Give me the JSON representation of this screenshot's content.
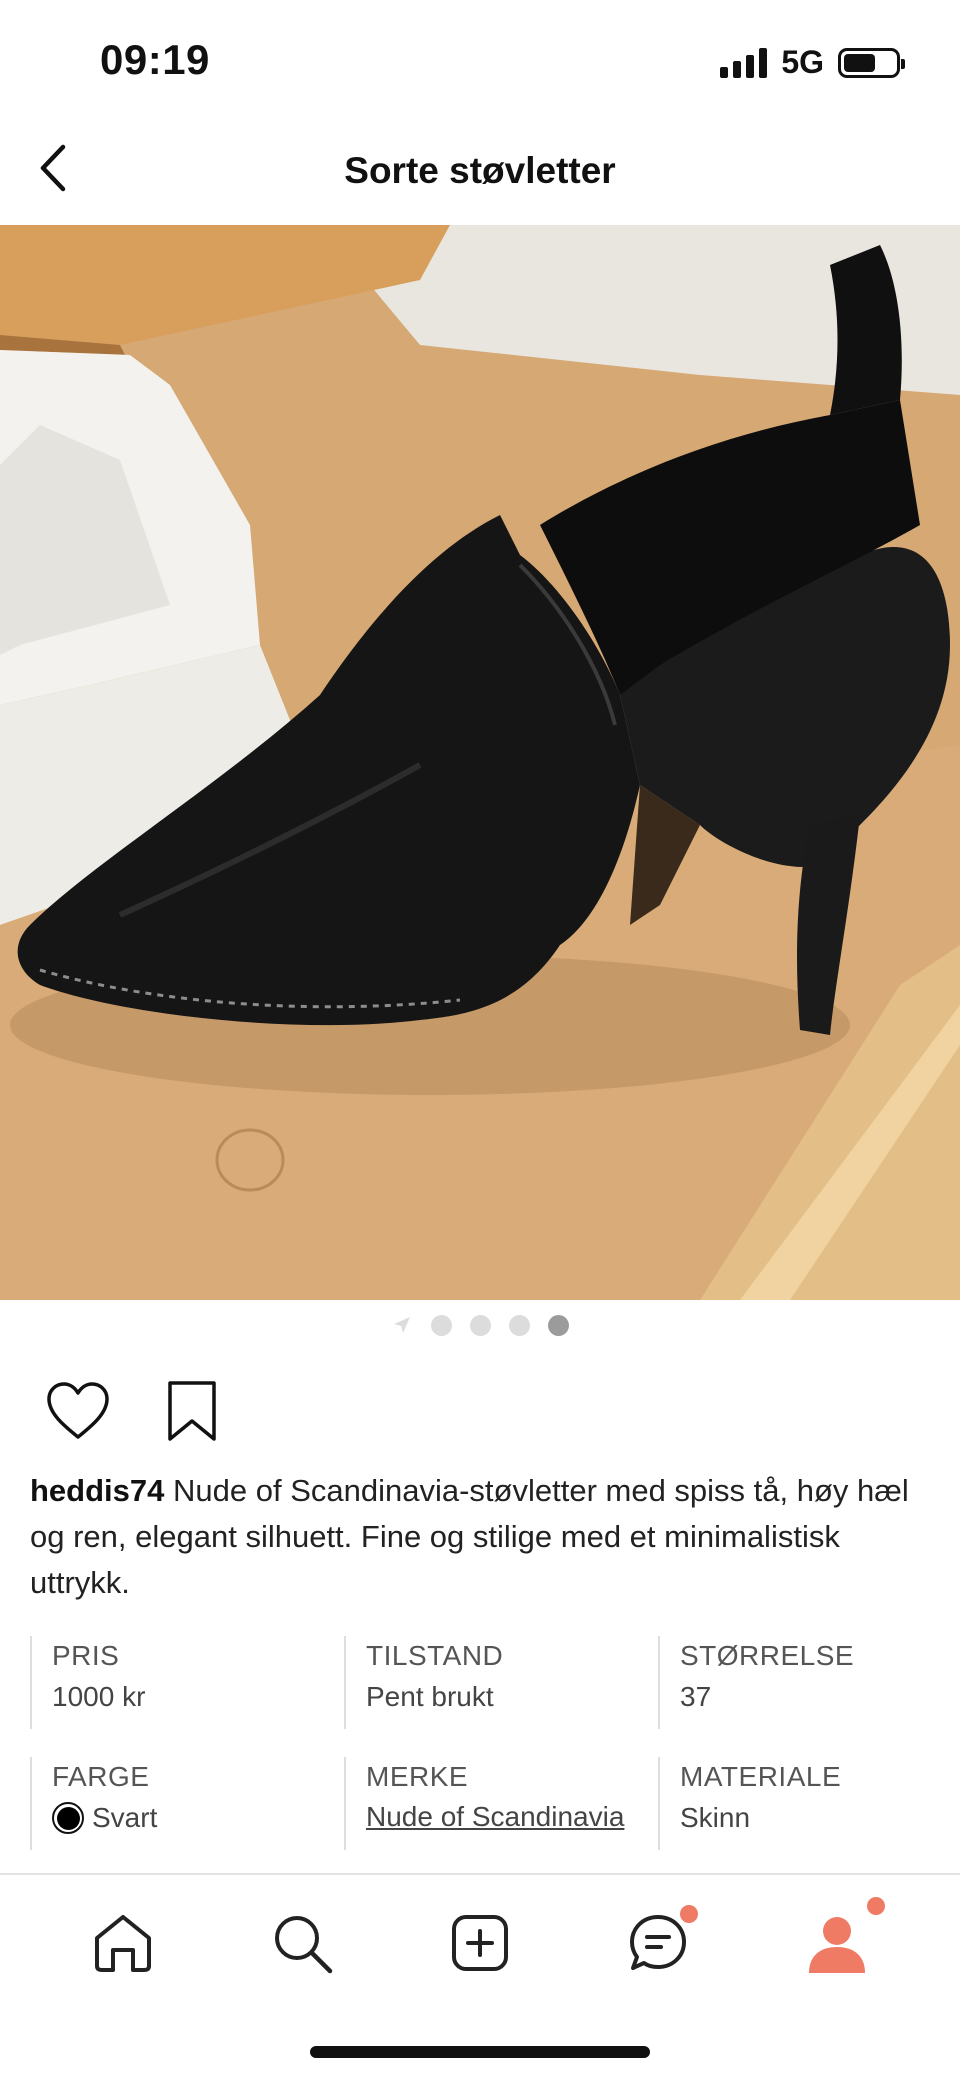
{
  "status_bar": {
    "time": "09:19",
    "network": "5G"
  },
  "header": {
    "title": "Sorte støvletter"
  },
  "gallery": {
    "image_count": 5,
    "active_index": 4
  },
  "post": {
    "username": "heddis74",
    "description": "Nude of Scandinavia-støvletter med spiss tå, høy hæl og ren, elegant silhuett. Fine og stilige med et minimalistisk uttrykk."
  },
  "attributes": {
    "price": {
      "label": "PRIS",
      "value": "1000 kr"
    },
    "condition": {
      "label": "TILSTAND",
      "value": "Pent brukt"
    },
    "size": {
      "label": "STØRRELSE",
      "value": "37"
    },
    "color": {
      "label": "FARGE",
      "value": "Svart",
      "swatch": "#000000"
    },
    "brand": {
      "label": "MERKE",
      "value": "Nude of Scandinavia"
    },
    "material": {
      "label": "MATERIALE",
      "value": "Skinn"
    }
  },
  "nav": {
    "items": [
      {
        "icon": "home-icon"
      },
      {
        "icon": "search-icon"
      },
      {
        "icon": "add-icon"
      },
      {
        "icon": "chat-icon",
        "badge": true
      },
      {
        "icon": "profile-icon",
        "badge": true
      }
    ],
    "accent": "#f07b64"
  }
}
